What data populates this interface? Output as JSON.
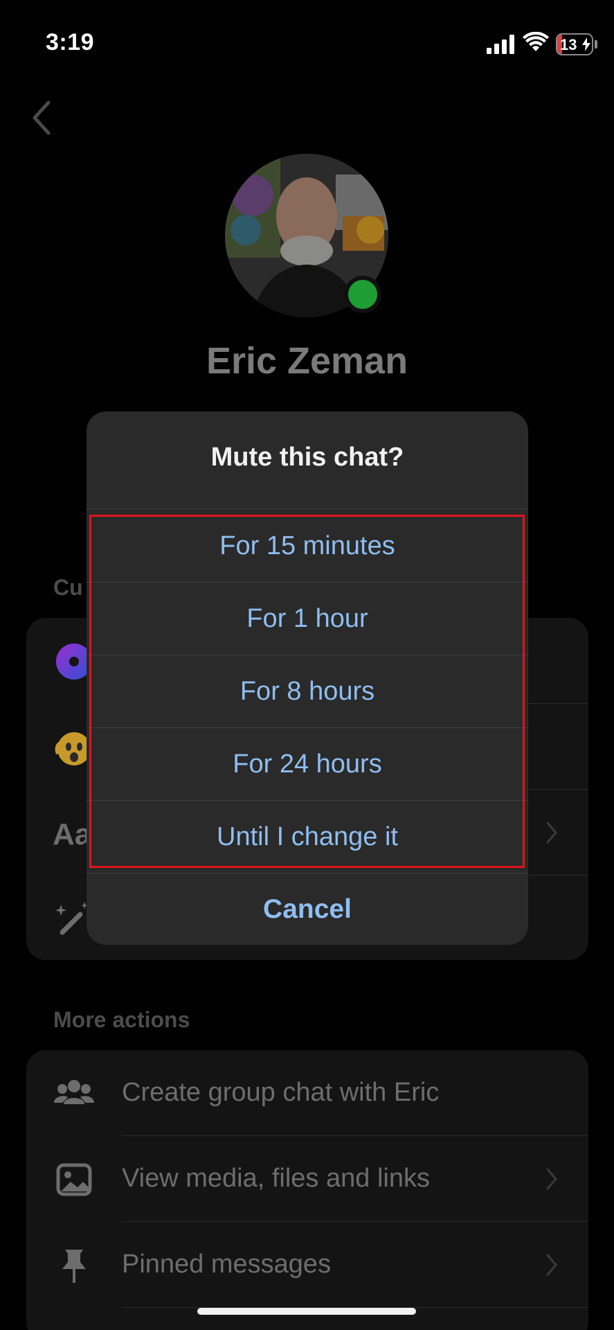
{
  "status_bar": {
    "time": "3:19",
    "battery": "13"
  },
  "profile": {
    "name": "Eric Zeman"
  },
  "customize": {
    "section_label_partial": "Cu",
    "rows": [
      {
        "icon": "theme-icon",
        "label": ""
      },
      {
        "icon": "quick-reaction-emoji-icon",
        "label": ""
      },
      {
        "icon": "nicknames-icon",
        "label": "Aa"
      },
      {
        "icon": "magic-wand-icon",
        "label": ""
      }
    ]
  },
  "more_actions": {
    "section_label": "More actions",
    "rows": [
      {
        "icon": "group-icon",
        "label": "Create group chat with Eric"
      },
      {
        "icon": "media-icon",
        "label": "View media, files and links"
      },
      {
        "icon": "pin-icon",
        "label": "Pinned messages"
      }
    ]
  },
  "mute_dialog": {
    "title": "Mute this chat?",
    "options": [
      "For 15 minutes",
      "For 1 hour",
      "For 8 hours",
      "For 24 hours",
      "Until I change it"
    ],
    "cancel_label": "Cancel"
  },
  "colors": {
    "accent": "#8fbef0",
    "highlight": "#e0141b",
    "presence": "#1e9d35"
  }
}
